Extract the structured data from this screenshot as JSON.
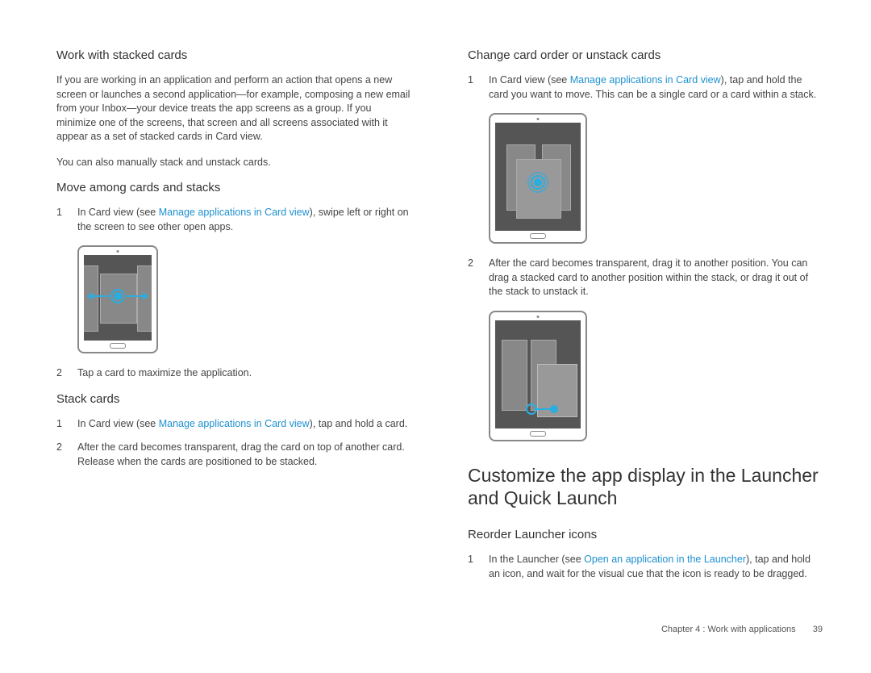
{
  "left": {
    "h_stacked": "Work with stacked cards",
    "p_stacked_1": "If you are working in an application and perform an action that opens a new screen or launches a second application—for example, composing a new email from your Inbox—your device treats the app screens as a group. If you minimize one of the screens, that screen and all screens associated with it appear as a set of stacked cards in Card view.",
    "p_stacked_2": "You can also manually stack and unstack cards.",
    "h_move": "Move among cards and stacks",
    "move_1_a": "In Card view (see ",
    "move_1_link": "Manage applications in Card view",
    "move_1_b": "), swipe left or right on the screen to see other open apps.",
    "move_2": "Tap a card to maximize the application.",
    "h_stack": "Stack cards",
    "stack_1_a": "In Card view (see ",
    "stack_1_link": "Manage applications in Card view",
    "stack_1_b": "), tap and hold a card.",
    "stack_2": "After the card becomes transparent, drag the card on top of another card. Release when the cards are positioned to be stacked."
  },
  "right": {
    "h_change": "Change card order or unstack cards",
    "change_1_a": "In Card view (see ",
    "change_1_link": "Manage applications in Card view",
    "change_1_b": "), tap and hold the card you want to move. This can be a single card or a card within a stack.",
    "change_2": "After the card becomes transparent, drag it to another position. You can drag a stacked card to another position within the stack, or drag it out of the stack to unstack it.",
    "h_customize": "Customize the app display in the Launcher and Quick Launch",
    "h_reorder": "Reorder Launcher icons",
    "reorder_1_a": "In the Launcher (see ",
    "reorder_1_link": "Open an application in the Launcher",
    "reorder_1_b": "), tap and hold an icon, and wait for the visual cue that the icon is ready to be dragged."
  },
  "footer": {
    "chapter": "Chapter 4 : Work with applications",
    "page": "39"
  }
}
